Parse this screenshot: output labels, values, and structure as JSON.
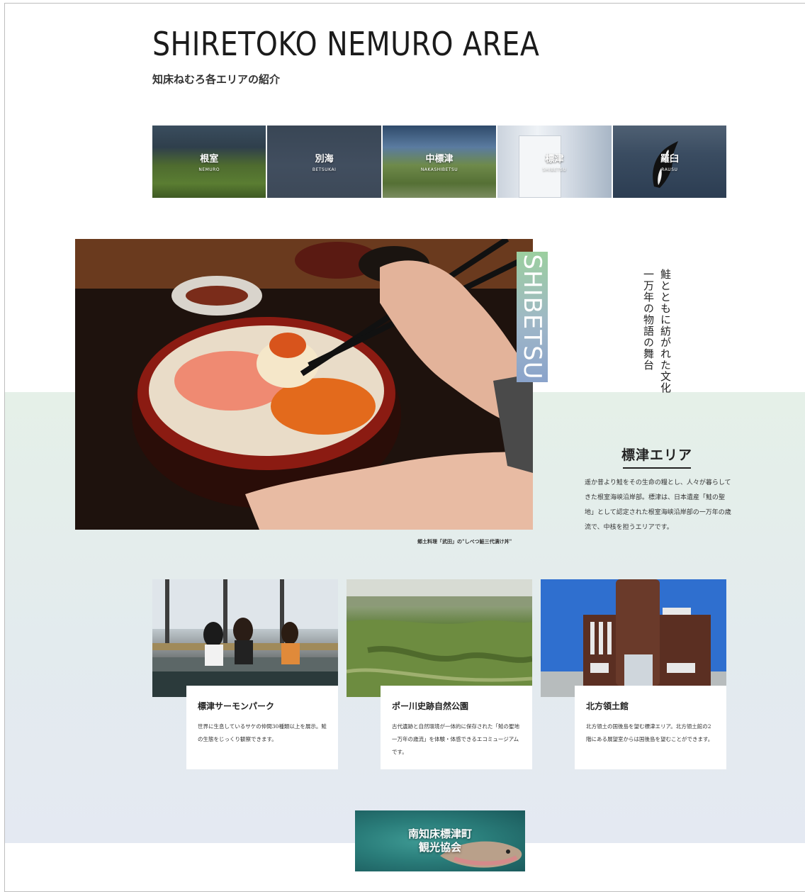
{
  "header": {
    "title": "SHIRETOKO NEMURO AREA",
    "subtitle": "知床ねむろ各エリアの紹介"
  },
  "nav": [
    {
      "jp": "根室",
      "en": "NEMURO"
    },
    {
      "jp": "別海",
      "en": "BETSUKAI"
    },
    {
      "jp": "中標津",
      "en": "NAKASHIBETSU"
    },
    {
      "jp": "標津",
      "en": "SHIBETSU"
    },
    {
      "jp": "羅臼",
      "en": "RAUSU"
    }
  ],
  "feature": {
    "badge": "SHIBETSU",
    "tagline": "鮭とともに紡がれた文化 一万年の物語の舞台",
    "caption": "郷土料理「武田」の\"しべつ鮭三代漬け丼\"",
    "area_title": "標津エリア",
    "area_body": "遥か昔より鮭をその生命の糧とし、人々が暮らしてきた根室海峡沿岸部。標津は、日本遺産「鮭の聖地」として認定された根室海峡沿岸部の一万年の歳流で、中核を担うエリアです。"
  },
  "cards": [
    {
      "title": "標津サーモンパーク",
      "desc": "世界に生息しているサケの仲間30種類以上を展示。鮭の生態をじっくり観察できます。"
    },
    {
      "title": "ポー川史跡自然公園",
      "desc": "古代遺跡と自然環境が一体的に保存された「鮭の聖地一万年の歳流」を体験・体感できるエコミュージアムです。"
    },
    {
      "title": "北方領土館",
      "desc": "北方領土の国後島を望む標津エリア。北方領土館の2階にある展望室からは国後島を望むことができます。"
    }
  ],
  "banner": {
    "line1": "南知床標津町",
    "line2": "観光協会"
  }
}
